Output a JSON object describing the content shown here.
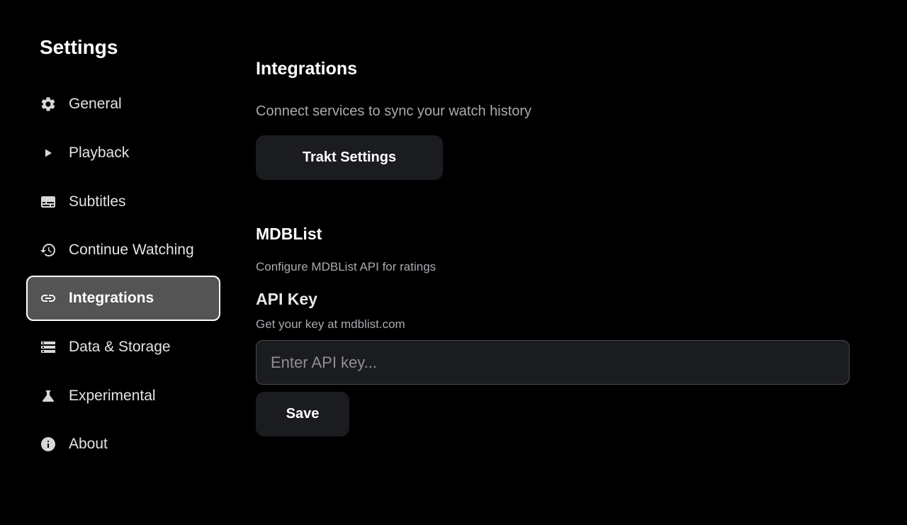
{
  "sidebar": {
    "title": "Settings",
    "items": [
      {
        "label": "General",
        "icon": "gear-icon",
        "active": false
      },
      {
        "label": "Playback",
        "icon": "play-icon",
        "active": false
      },
      {
        "label": "Subtitles",
        "icon": "subtitles-icon",
        "active": false
      },
      {
        "label": "Continue Watching",
        "icon": "history-icon",
        "active": false
      },
      {
        "label": "Integrations",
        "icon": "link-icon",
        "active": true
      },
      {
        "label": "Data & Storage",
        "icon": "storage-icon",
        "active": false
      },
      {
        "label": "Experimental",
        "icon": "flask-icon",
        "active": false
      },
      {
        "label": "About",
        "icon": "info-icon",
        "active": false
      }
    ]
  },
  "main": {
    "title": "Integrations",
    "subtitle": "Connect services to sync your watch history",
    "trakt_button": "Trakt Settings",
    "mdblist": {
      "title": "MDBList",
      "description": "Configure MDBList API for ratings",
      "api_key_label": "API Key",
      "api_key_hint": "Get your key at mdblist.com",
      "api_key_value": "",
      "api_key_placeholder": "Enter API key...",
      "save_button": "Save"
    }
  },
  "colors": {
    "background": "#000000",
    "surface": "#1b1c20",
    "active_item": "#545454",
    "muted_text": "#a9aab0"
  }
}
